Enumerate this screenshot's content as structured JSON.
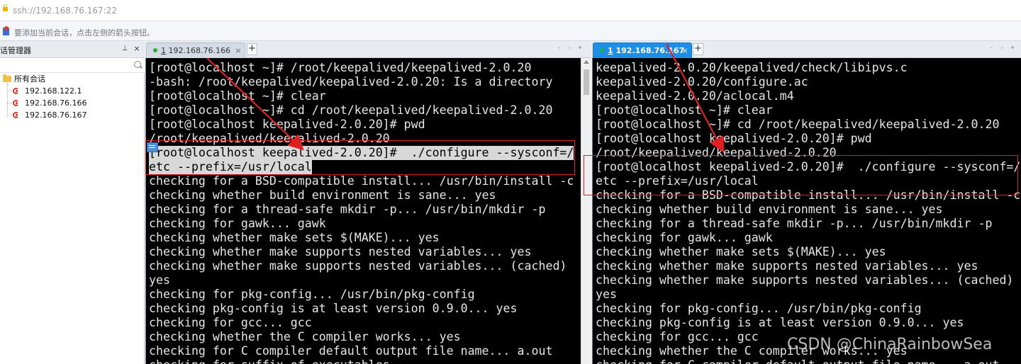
{
  "address_bar": {
    "url": "ssh://192.168.76.167:22"
  },
  "hint_bar": {
    "text": "要添加当前会话，点击左侧的箭头按钮。"
  },
  "session_manager": {
    "title": "话管理器",
    "pin_glyph": "⊥",
    "close_glyph": "×",
    "root": "所有会话",
    "sessions": [
      "192.168.122.1",
      "192.168.76.166",
      "192.168.76.167"
    ]
  },
  "left_pane": {
    "tab": {
      "index": "1",
      "label": "192.168.76.166",
      "close": "×"
    },
    "add_tab": "+",
    "nav": "‹ › ▾",
    "lines": [
      "[root@localhost ~]# /root/keepalived/keepalived-2.0.20",
      "-bash: /root/keepalived/keepalived-2.0.20: Is a directory",
      "[root@localhost ~]# clear",
      "[root@localhost ~]# cd /root/keepalived/keepalived-2.0.20",
      "[root@localhost keepalived-2.0.20]# pwd",
      "/root/keepalived/keepalived-2.0.20",
      "[root@localhost keepalived-2.0.20]#  ./configure --sysconf=/",
      "etc --prefix=/usr/local",
      "checking for a BSD-compatible install... /usr/bin/install -c",
      "checking whether build environment is sane... yes",
      "checking for a thread-safe mkdir -p... /usr/bin/mkdir -p",
      "checking for gawk... gawk",
      "checking whether make sets $(MAKE)... yes",
      "checking whether make supports nested variables... yes",
      "checking whether make supports nested variables... (cached)",
      "yes",
      "checking for pkg-config... /usr/bin/pkg-config",
      "checking pkg-config is at least version 0.9.0... yes",
      "checking for gcc... gcc",
      "checking whether the C compiler works... yes",
      "checking for C compiler default output file name... a.out",
      "checking for suffix of executables..."
    ]
  },
  "right_pane": {
    "tab": {
      "index": "1",
      "label": "192.168.76.167",
      "close": "×"
    },
    "add_tab": "+",
    "nav": "‹ › ▾",
    "lines": [
      "keepalived-2.0.20/keepalived/check/libipvs.c",
      "keepalived-2.0.20/configure.ac",
      "keepalived-2.0.20/aclocal.m4",
      "[root@localhost ~]# clear",
      "[root@localhost ~]# cd /root/keepalived/keepalived-2.0.20",
      "[root@localhost keepalived-2.0.20]# pwd",
      "/root/keepalived/keepalived-2.0.20",
      "[root@localhost keepalived-2.0.20]#  ./configure --sysconf=/",
      "etc --prefix=/usr/local",
      "checking for a BSD-compatible install... /usr/bin/install -c",
      "checking whether build environment is sane... yes",
      "checking for a thread-safe mkdir -p... /usr/bin/mkdir -p",
      "checking for gawk... gawk",
      "checking whether make sets $(MAKE)... yes",
      "checking whether make supports nested variables... yes",
      "checking whether make supports nested variables... (cached)",
      "yes",
      "checking for pkg-config... /usr/bin/pkg-config",
      "checking pkg-config is at least version 0.9.0... yes",
      "checking for gcc... gcc",
      "checking whether the C compiler works... yes",
      "checking for C compiler default output file name... a.out"
    ]
  },
  "watermark": "CSDN @ChinaRainbowSea",
  "colors": {
    "terminal_bg": "#000000",
    "terminal_fg": "#e6e6e6",
    "highlight": "#e02020",
    "tab_active": "#1e8fe6",
    "status_dot": "#1fb33a"
  }
}
